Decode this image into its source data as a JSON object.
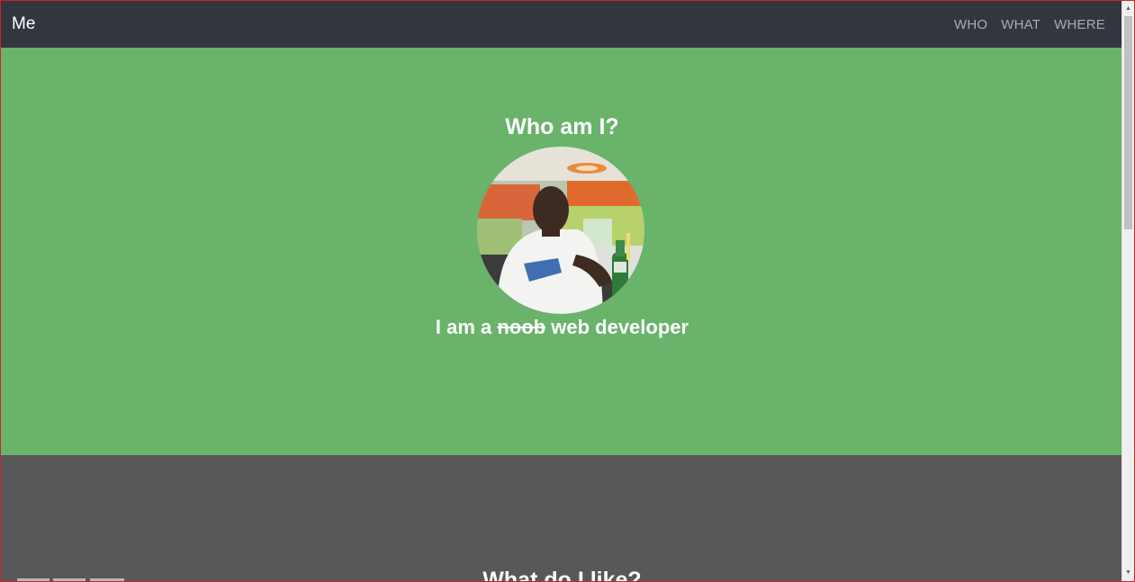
{
  "navbar": {
    "brand": "Me",
    "links": [
      "WHO",
      "WHAT",
      "WHERE"
    ]
  },
  "hero": {
    "title": "Who am I?",
    "subtitle_prefix": "I am a ",
    "subtitle_struck": "noob",
    "subtitle_suffix": " web developer"
  },
  "section2": {
    "title": "What do I like?"
  },
  "colors": {
    "navbar_bg": "#33363e",
    "hero_bg": "#69b36b",
    "section2_bg": "#58585a",
    "frame_border": "#c9252b"
  },
  "icons": {
    "scroll_up": "scroll-up-arrow",
    "scroll_down": "scroll-down-arrow"
  }
}
